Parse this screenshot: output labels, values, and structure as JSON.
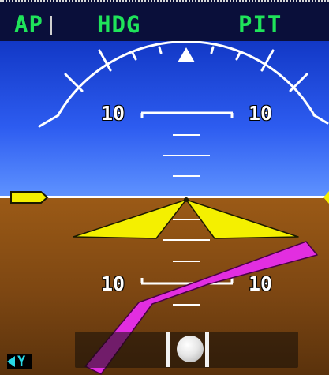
{
  "fma": {
    "left_mode": "AP",
    "center_mode": "HDG",
    "right_mode": "PIT"
  },
  "attitude": {
    "pitch_labels": {
      "upper_left": "10",
      "upper_right": "10",
      "lower_left": "10",
      "lower_right": "10"
    },
    "colors": {
      "sky": "#2d5cf0",
      "ground": "#7c4612",
      "aircraft_symbol": "#f4f000",
      "flight_director": "#e22ee0",
      "fma_text": "#1fe35a",
      "mode_indicator": "#29d8e6"
    }
  },
  "status": {
    "mode_indicator": "Y",
    "mode_indicator_icon": "left-triangle-icon"
  }
}
